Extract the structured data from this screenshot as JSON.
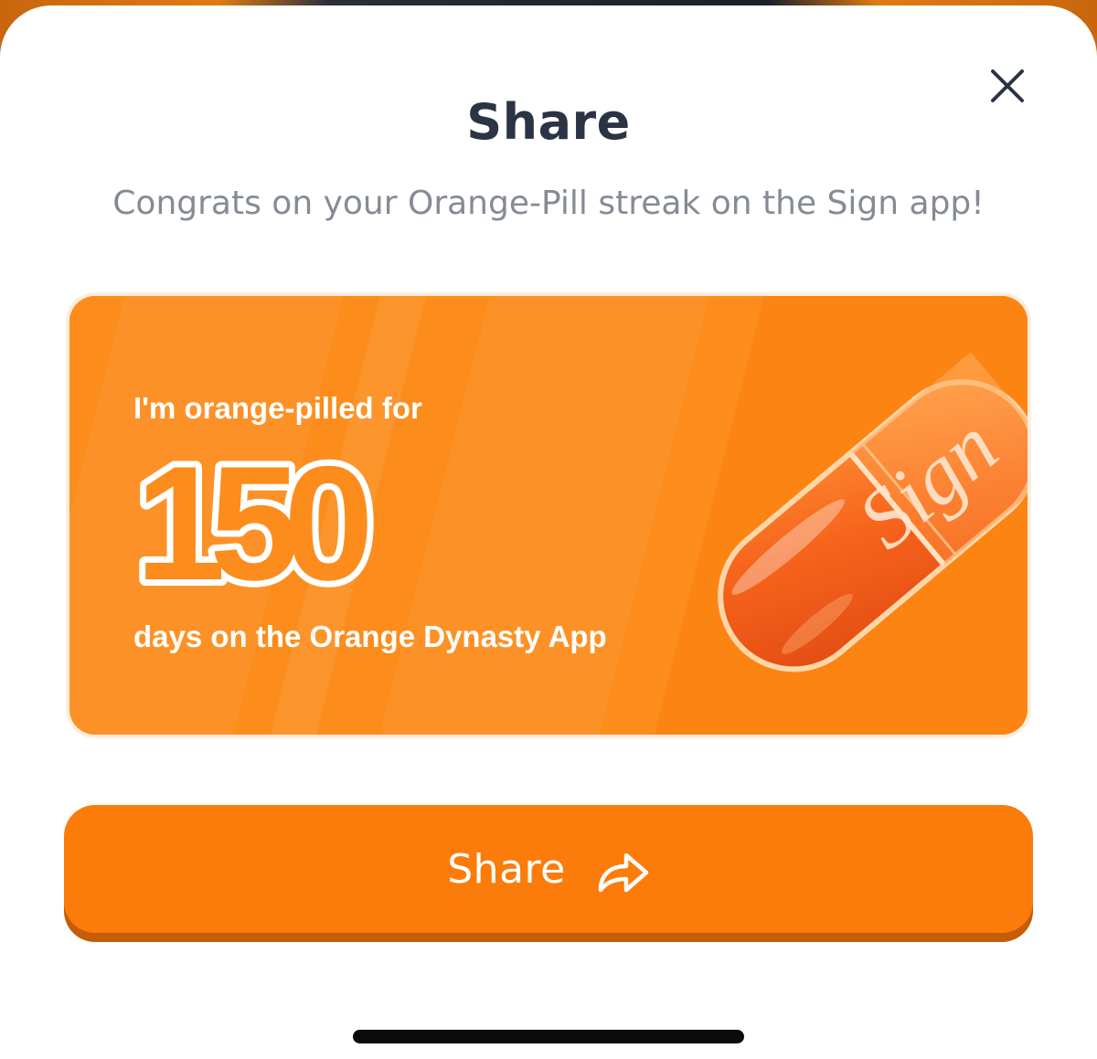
{
  "modal": {
    "title": "Share",
    "subtitle": "Congrats on your Orange-Pill streak on the Sign app!",
    "close_icon": "close-icon"
  },
  "card": {
    "line1": "I'm orange-pilled for",
    "days": "150",
    "line2": "days on the Orange Dynasty App",
    "pill_brand": "Sign",
    "background_color": "#fc8d1c"
  },
  "share_button": {
    "label": "Share",
    "icon": "share-arrow-icon",
    "color": "#fb7c0a"
  }
}
